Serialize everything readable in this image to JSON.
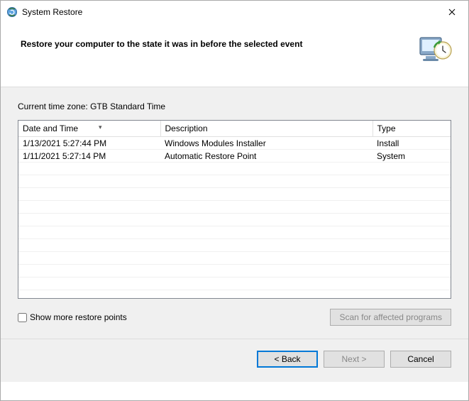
{
  "window": {
    "title": "System Restore"
  },
  "header": {
    "heading": "Restore your computer to the state it was in before the selected event"
  },
  "timezone": {
    "label": "Current time zone:",
    "value": "GTB Standard Time"
  },
  "table": {
    "columns": {
      "date": "Date and Time",
      "description": "Description",
      "type": "Type"
    },
    "rows": [
      {
        "date": "1/13/2021 5:27:44 PM",
        "description": "Windows Modules Installer",
        "type": "Install"
      },
      {
        "date": "1/11/2021 5:27:14 PM",
        "description": "Automatic Restore Point",
        "type": "System"
      }
    ]
  },
  "checkbox": {
    "label": "Show more restore points",
    "checked": false
  },
  "buttons": {
    "scan": "Scan for affected programs",
    "back": "< Back",
    "next": "Next >",
    "cancel": "Cancel"
  }
}
